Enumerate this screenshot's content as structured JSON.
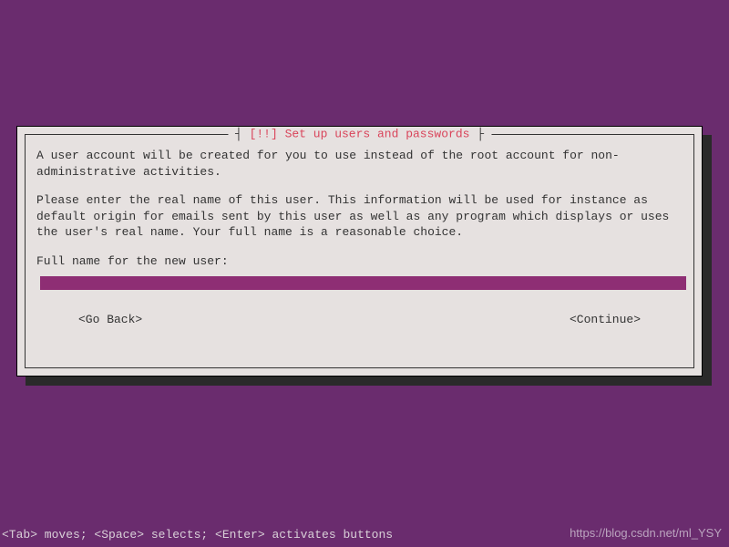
{
  "dialog": {
    "title": "[!!] Set up users and passwords",
    "paragraph1": "A user account will be created for you to use instead of the root account for non-administrative activities.",
    "paragraph2": "Please enter the real name of this user. This information will be used for instance as default origin for emails sent by this user as well as any program which displays or uses the user's real name. Your full name is a reasonable choice.",
    "prompt_label": "Full name for the new user:",
    "input_value": "",
    "back_label": "<Go Back>",
    "continue_label": "<Continue>"
  },
  "footer": {
    "help_text": "<Tab> moves; <Space> selects; <Enter> activates buttons"
  },
  "watermark": "https://blog.csdn.net/ml_YSY"
}
